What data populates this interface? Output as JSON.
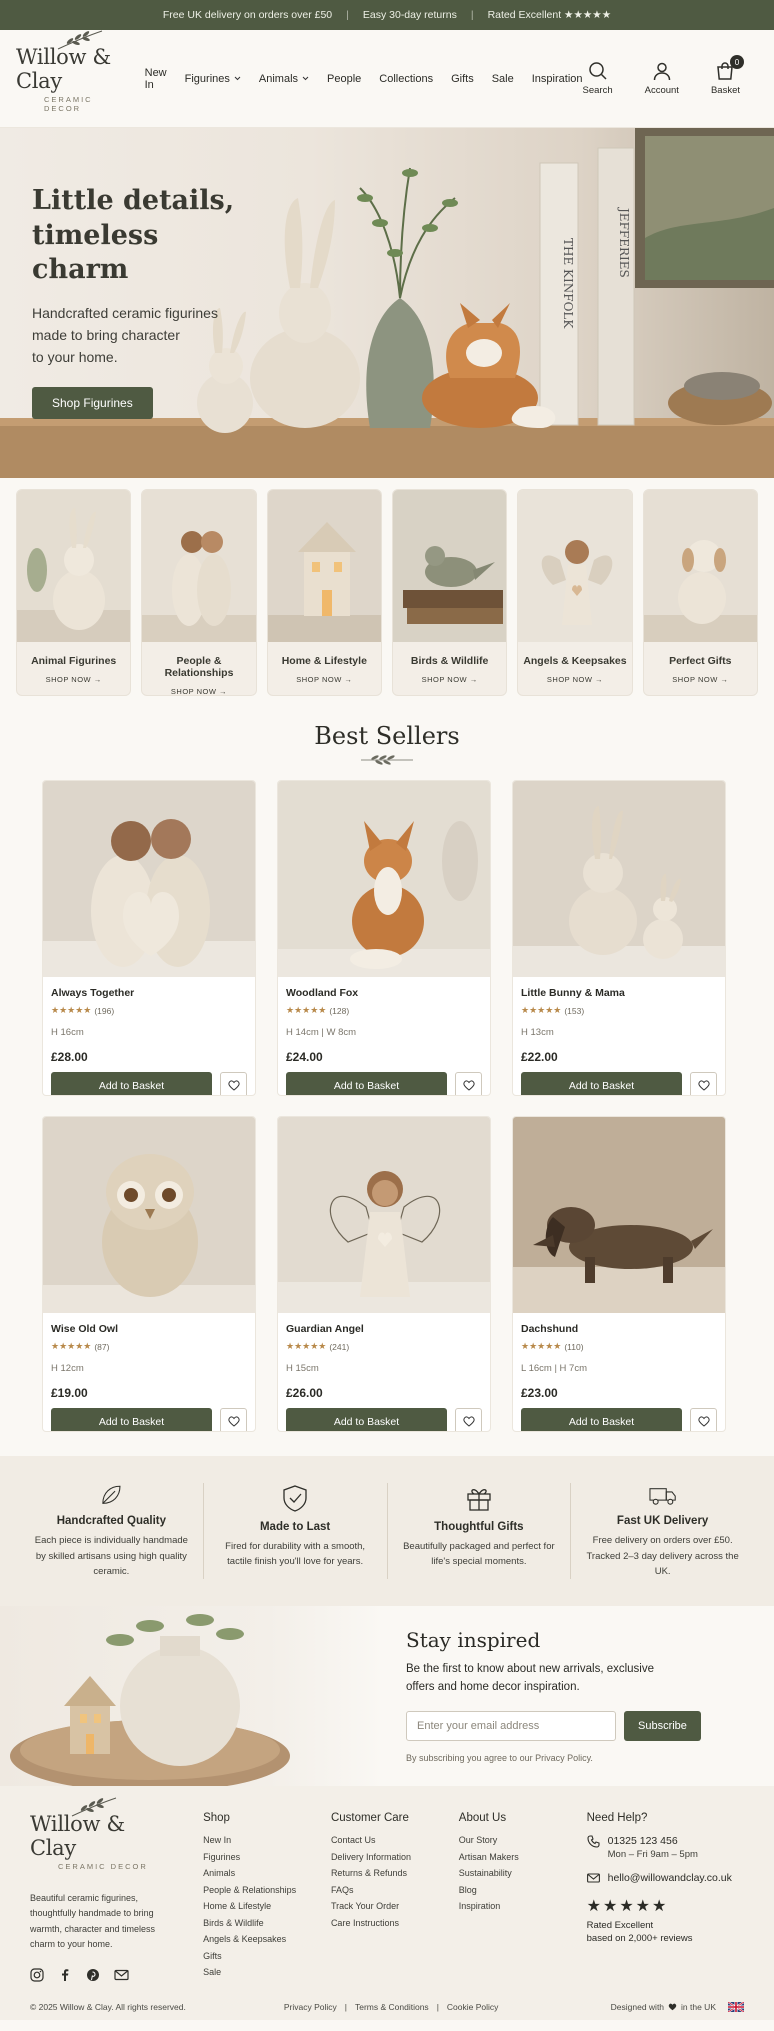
{
  "colors": {
    "accent": "#4f5a42",
    "background": "#faf8f4",
    "star": "#b8894a"
  },
  "announcement": {
    "items": [
      "Free UK delivery on orders over £50",
      "Easy 30-day returns",
      "Rated Excellent ★★★★★"
    ],
    "separator": "|"
  },
  "header": {
    "logo": {
      "name": "Willow & Clay",
      "tagline": "CERAMIC DECOR"
    },
    "nav": [
      {
        "label": "New In",
        "icon": ""
      },
      {
        "label": "Figurines",
        "icon": "chevron-down-icon"
      },
      {
        "label": "Animals",
        "icon": "chevron-down-icon"
      },
      {
        "label": "People",
        "icon": ""
      },
      {
        "label": "Collections",
        "icon": ""
      },
      {
        "label": "Gifts",
        "icon": ""
      },
      {
        "label": "Sale",
        "icon": ""
      },
      {
        "label": "Inspiration",
        "icon": ""
      }
    ],
    "search_label": "Search",
    "account_label": "Account",
    "basket_label": "Basket",
    "basket_count": "0"
  },
  "hero": {
    "title_line1": "Little details,",
    "title_line2": "timeless charm",
    "subtitle_line1": "Handcrafted ceramic figurines",
    "subtitle_line2": "made to bring character",
    "subtitle_line3": "to your home.",
    "cta": "Shop Figurines",
    "book_title": "THE KINFOLK",
    "book_title2": "JEFFERIES"
  },
  "categories": [
    {
      "label": "Animal Figurines",
      "cta": "SHOP NOW →"
    },
    {
      "label": "People & Relationships",
      "cta": "SHOP NOW →"
    },
    {
      "label": "Home & Lifestyle",
      "cta": "SHOP NOW →"
    },
    {
      "label": "Birds & Wildlife",
      "cta": "SHOP NOW →"
    },
    {
      "label": "Angels & Keepsakes",
      "cta": "SHOP NOW →"
    },
    {
      "label": "Perfect Gifts",
      "cta": "SHOP NOW →"
    }
  ],
  "best_sellers": {
    "title": "Best Sellers",
    "add_label": "Add to Basket",
    "products": [
      {
        "name": "Always Together",
        "rating": 4.5,
        "stars": "★★★★★",
        "reviews": "(196)",
        "dims": "H 16cm",
        "price": "£28.00"
      },
      {
        "name": "Woodland Fox",
        "rating": 4.5,
        "stars": "★★★★★",
        "reviews": "(128)",
        "dims": "H 14cm  |  W 8cm",
        "price": "£24.00"
      },
      {
        "name": "Little Bunny & Mama",
        "rating": 4.5,
        "stars": "★★★★★",
        "reviews": "(153)",
        "dims": "H 13cm",
        "price": "£22.00"
      },
      {
        "name": "Wise Old Owl",
        "rating": 4.5,
        "stars": "★★★★★",
        "reviews": "(87)",
        "dims": "H 12cm",
        "price": "£19.00"
      },
      {
        "name": "Guardian Angel",
        "rating": 4.5,
        "stars": "★★★★★",
        "reviews": "(241)",
        "dims": "H 15cm",
        "price": "£26.00"
      },
      {
        "name": "Dachshund",
        "rating": 4.5,
        "stars": "★★★★★",
        "reviews": "(110)",
        "dims": "L 16cm  |  H 7cm",
        "price": "£23.00"
      }
    ]
  },
  "features": [
    {
      "icon": "leaf-icon",
      "title": "Handcrafted Quality",
      "text": "Each piece is individually handmade by skilled artisans using high quality ceramic."
    },
    {
      "icon": "shield-check-icon",
      "title": "Made to Last",
      "text": "Fired for durability with a smooth, tactile finish you'll love for years."
    },
    {
      "icon": "gift-icon",
      "title": "Thoughtful Gifts",
      "text": "Beautifully packaged and perfect for life's special moments."
    },
    {
      "icon": "truck-icon",
      "title": "Fast UK Delivery",
      "text": "Free delivery on orders over £50. Tracked 2–3 day delivery across the UK."
    }
  ],
  "newsletter": {
    "title": "Stay inspired",
    "text": "Be the first to know about new arrivals, exclusive offers and home decor inspiration.",
    "placeholder": "Enter your email address",
    "button": "Subscribe",
    "note": "By subscribing you agree to our Privacy Policy."
  },
  "footer": {
    "description": "Beautiful ceramic figurines, thoughtfully handmade to bring warmth, character and timeless charm to your home.",
    "shop": {
      "title": "Shop",
      "links": [
        "New In",
        "Figurines",
        "Animals",
        "People & Relationships",
        "Home & Lifestyle",
        "Birds & Wildlife",
        "Angels & Keepsakes",
        "Gifts",
        "Sale"
      ]
    },
    "care": {
      "title": "Customer Care",
      "links": [
        "Contact Us",
        "Delivery Information",
        "Returns & Refunds",
        "FAQs",
        "Track Your Order",
        "Care Instructions"
      ]
    },
    "about": {
      "title": "About Us",
      "links": [
        "Our Story",
        "Artisan Makers",
        "Sustainability",
        "Blog",
        "Inspiration"
      ]
    },
    "help": {
      "title": "Need Help?",
      "phone": "01325 123 456",
      "hours": "Mon – Fri 9am – 5pm",
      "email": "hello@willowandclay.co.uk",
      "stars": "★★★★★",
      "rating_label": "Rated Excellent",
      "rating_sub": "based on 2,000+ reviews"
    },
    "copyright": "© 2025 Willow & Clay. All rights reserved.",
    "legal": [
      "Privacy Policy",
      "Terms & Conditions",
      "Cookie Policy"
    ],
    "designed_prefix": "Designed with",
    "designed_suffix": "in the UK"
  }
}
